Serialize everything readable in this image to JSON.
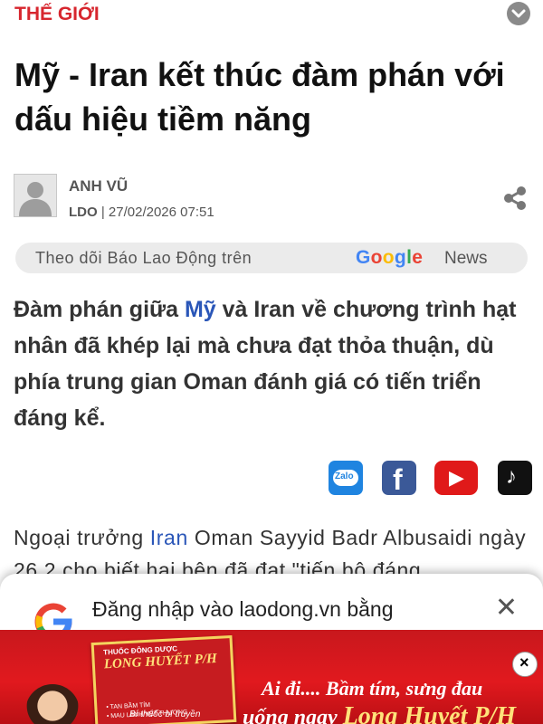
{
  "category": "THẾ GIỚI",
  "headline": "Mỹ - Iran kết thúc đàm phán với dấu hiệu tiềm năng",
  "author": {
    "name": "ANH VŨ",
    "source": "LDO",
    "separator": " | ",
    "datetime": "27/02/2026 07:51"
  },
  "google_news_banner": {
    "text": "Theo dõi Báo Lao Động trên",
    "logo": "Google",
    "suffix": "News"
  },
  "sapo": {
    "part1": "Đàm phán giữa ",
    "link": "Mỹ",
    "part2": " và Iran về chương trình hạt nhân đã khép lại mà chưa đạt thỏa thuận, dù phía trung gian Oman đánh giá có tiến triển đáng kể."
  },
  "social": {
    "zalo_label": "Zalo",
    "facebook_glyph": "f",
    "youtube_glyph": "▶",
    "tiktok_glyph": "♪"
  },
  "body": {
    "part1": "Ngoại trưởng ",
    "link": "Iran",
    "part2": " Oman Sayyid Badr Albusaidi ngày 26.2 cho biết hai bên đã đạt \"tiến bộ đáng"
  },
  "login_popup": {
    "title": "Đăng nhập vào laodong.vn bằng",
    "close": "✕"
  },
  "ad": {
    "box_small": "THUỐC ĐÔNG DƯỢC",
    "box_title": "LONG HUYẾT P/H",
    "box_feat1": "• TAN BẦM TÍM",
    "box_feat2": "• MAU LÀNH VẾT THƯƠNG",
    "line1": "Ai đi.... Bầm tím, sưng đau",
    "line2_prefix": "uống ngay ",
    "line2_brand": "Long Huyết P/H",
    "sub": "Bí thuốc bí truyền",
    "close": "×"
  },
  "colors": {
    "accent": "#d7262e",
    "link": "#2a56b8"
  }
}
